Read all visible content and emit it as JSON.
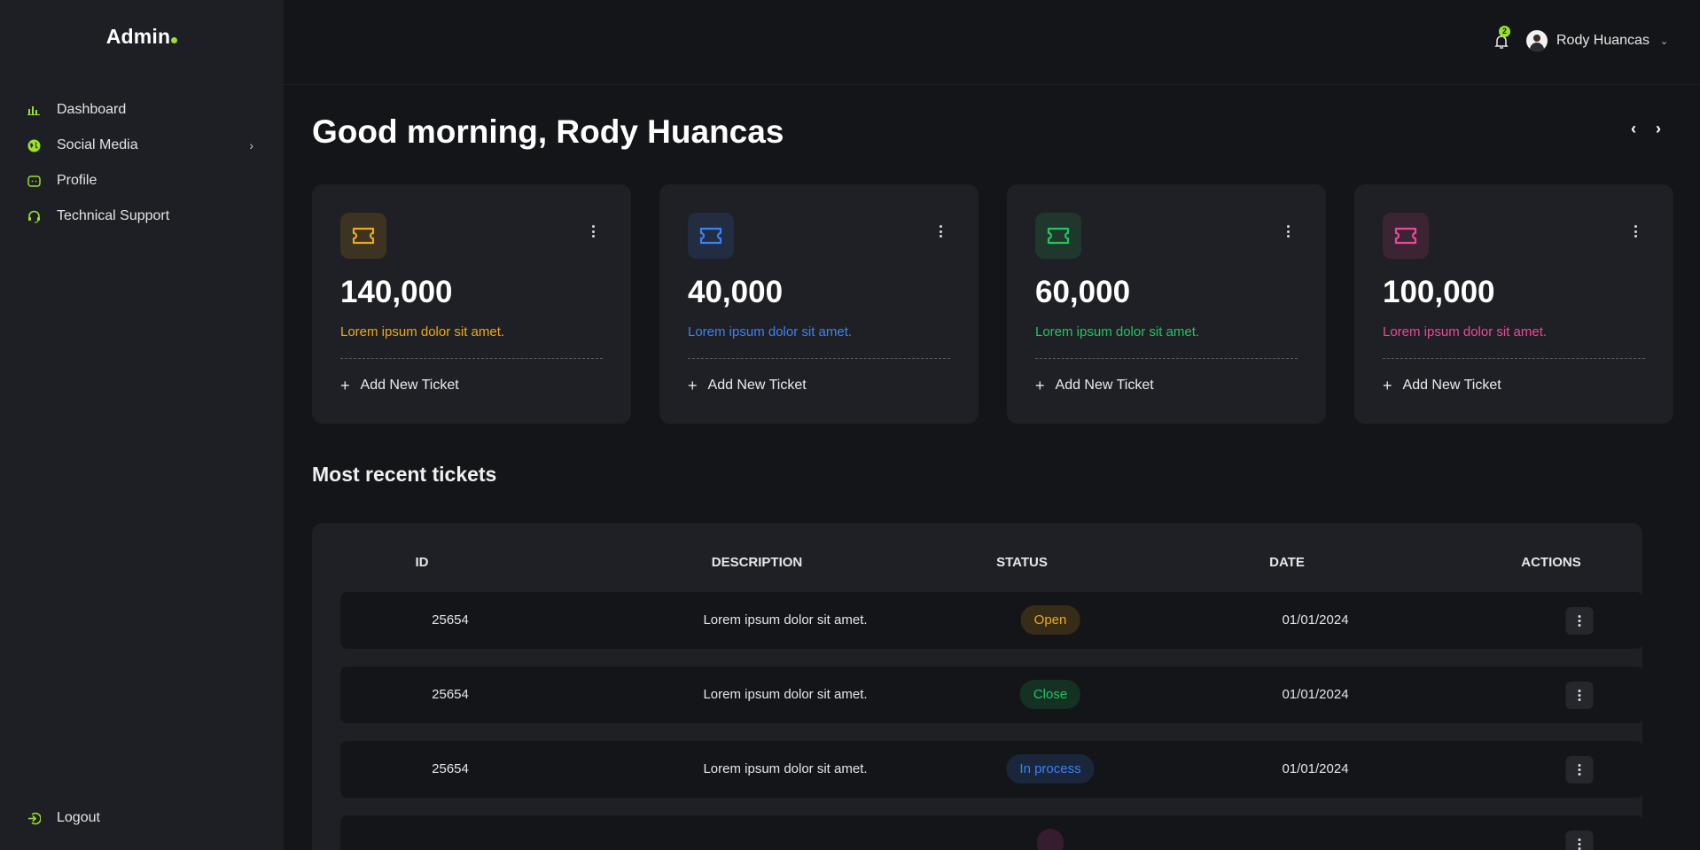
{
  "app": {
    "logo_text": "Admin",
    "accent": "#9be02b"
  },
  "sidebar": {
    "items": [
      {
        "label": "Dashboard",
        "icon": "bar-chart-icon"
      },
      {
        "label": "Social Media",
        "icon": "globe-icon",
        "has_submenu": true
      },
      {
        "label": "Profile",
        "icon": "profile-card-icon"
      },
      {
        "label": "Technical Support",
        "icon": "headset-icon"
      }
    ],
    "logout_label": "Logout"
  },
  "header": {
    "notification_count": "2",
    "user_name": "Rody Huancas"
  },
  "main": {
    "greeting": "Good morning, Rody Huancas",
    "cards": [
      {
        "value": "140,000",
        "description": "Lorem ipsum dolor sit amet.",
        "action": "Add New Ticket",
        "color": "#f0a818",
        "icon": "ticket-icon"
      },
      {
        "value": "40,000",
        "description": "Lorem ipsum dolor sit amet.",
        "action": "Add New Ticket",
        "color": "#3b82f6",
        "icon": "ticket-icon"
      },
      {
        "value": "60,000",
        "description": "Lorem ipsum dolor sit amet.",
        "action": "Add New Ticket",
        "color": "#22c55e",
        "icon": "ticket-icon"
      },
      {
        "value": "100,000",
        "description": "Lorem ipsum dolor sit amet.",
        "action": "Add New Ticket",
        "color": "#ec4899",
        "icon": "ticket-icon"
      }
    ],
    "section_title": "Most recent tickets",
    "table": {
      "columns": [
        "ID",
        "DESCRIPTION",
        "STATUS",
        "DATE",
        "ACTIONS"
      ],
      "rows": [
        {
          "id": "25654",
          "description": "Lorem ipsum dolor sit amet.",
          "status": "Open",
          "status_color": "#f0a818",
          "date": "01/01/2024"
        },
        {
          "id": "25654",
          "description": "Lorem ipsum dolor sit amet.",
          "status": "Close",
          "status_color": "#22c55e",
          "date": "01/01/2024"
        },
        {
          "id": "25654",
          "description": "Lorem ipsum dolor sit amet.",
          "status": "In process",
          "status_color": "#3b82f6",
          "date": "01/01/2024"
        },
        {
          "id": "",
          "description": "",
          "status": "",
          "status_color": "#ec4899",
          "date": ""
        }
      ]
    }
  }
}
